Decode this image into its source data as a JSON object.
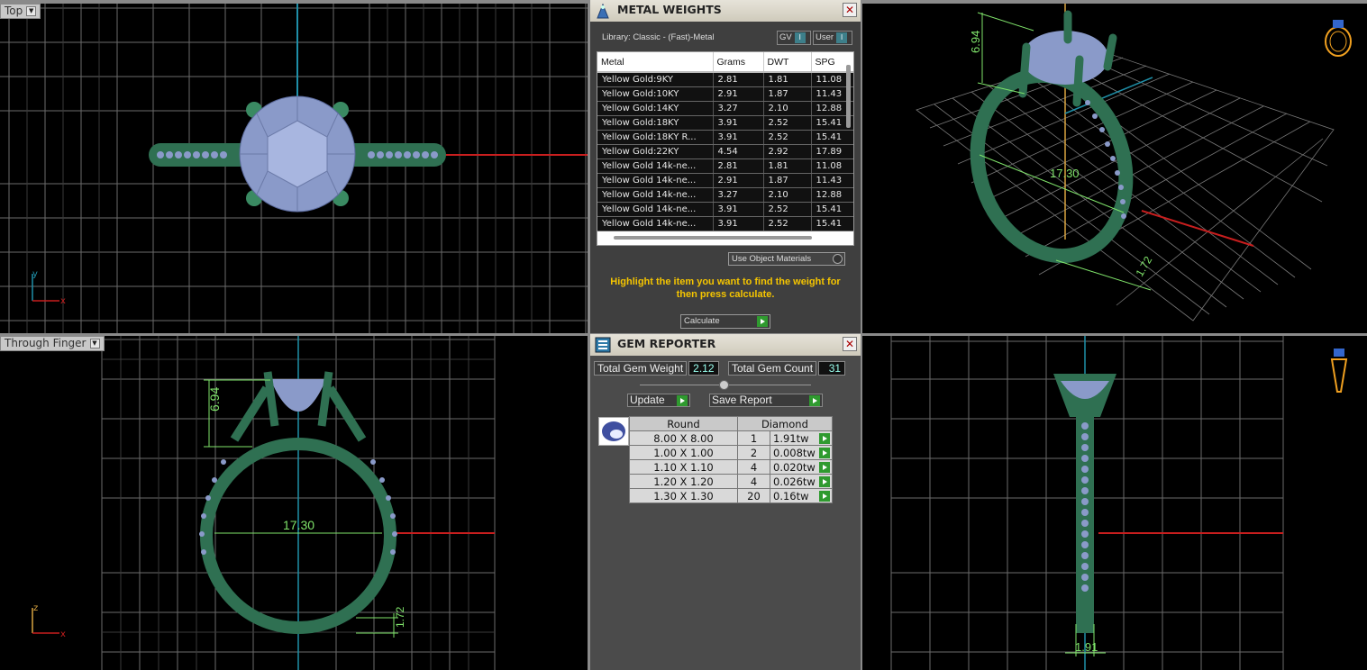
{
  "viewports": {
    "top": {
      "label": "Top",
      "axis_y": "y",
      "axis_x": "x"
    },
    "front": {
      "label": "Through Finger",
      "axis_z": "z",
      "axis_x": "x",
      "dim_height": "6.94",
      "dim_width": "17.30",
      "dim_shank": "1.72"
    },
    "perspective": {
      "dim_height": "6.94",
      "dim_width": "17.30",
      "dim_shank": "1.72"
    },
    "side": {
      "dim_width": "1.91"
    }
  },
  "metal_weights": {
    "title": "METAL WEIGHTS",
    "library": "Library: Classic - (Fast)-Metal",
    "gv_label": "GV",
    "user_label": "User",
    "columns": [
      "Metal",
      "Grams",
      "DWT",
      "SPG"
    ],
    "rows": [
      [
        "Yellow Gold:9KY",
        "2.81",
        "1.81",
        "11.08"
      ],
      [
        "Yellow Gold:10KY",
        "2.91",
        "1.87",
        "11.43"
      ],
      [
        "Yellow Gold:14KY",
        "3.27",
        "2.10",
        "12.88"
      ],
      [
        "Yellow Gold:18KY",
        "3.91",
        "2.52",
        "15.41"
      ],
      [
        "Yellow Gold:18KY R...",
        "3.91",
        "2.52",
        "15.41"
      ],
      [
        "Yellow Gold:22KY",
        "4.54",
        "2.92",
        "17.89"
      ],
      [
        "Yellow Gold 14k-ne...",
        "2.81",
        "1.81",
        "11.08"
      ],
      [
        "Yellow Gold 14k-ne...",
        "2.91",
        "1.87",
        "11.43"
      ],
      [
        "Yellow Gold 14k-ne...",
        "3.27",
        "2.10",
        "12.88"
      ],
      [
        "Yellow Gold 14k-ne...",
        "3.91",
        "2.52",
        "15.41"
      ],
      [
        "Yellow Gold 14k-ne...",
        "3.91",
        "2.52",
        "15.41"
      ]
    ],
    "use_object_materials": "Use Object Materials",
    "hint": "Highlight the item you want to find the weight for then press calculate.",
    "calculate_label": "Calculate"
  },
  "gem_reporter": {
    "title": "GEM REPORTER",
    "total_weight_label": "Total Gem Weight",
    "total_weight": "2.12",
    "total_count_label": "Total Gem Count",
    "total_count": "31",
    "update_label": "Update",
    "save_report_label": "Save Report",
    "shape_header": "Round",
    "material_header": "Diamond",
    "rows": [
      {
        "size": "8.00 X 8.00",
        "count": "1",
        "weight": "1.91tw"
      },
      {
        "size": "1.00 X 1.00",
        "count": "2",
        "weight": "0.008tw"
      },
      {
        "size": "1.10 X 1.10",
        "count": "4",
        "weight": "0.020tw"
      },
      {
        "size": "1.20 X 1.20",
        "count": "4",
        "weight": "0.026tw"
      },
      {
        "size": "1.30 X 1.30",
        "count": "20",
        "weight": "0.16tw"
      }
    ]
  },
  "colors": {
    "metal": "#2f7052",
    "gem": "#8a9ac9",
    "grid": "#6b6b6b",
    "dimension": "#7fe36a",
    "axis_red": "#c81e1e",
    "axis_blue": "#1f8fa8",
    "hint": "#f5c500"
  }
}
